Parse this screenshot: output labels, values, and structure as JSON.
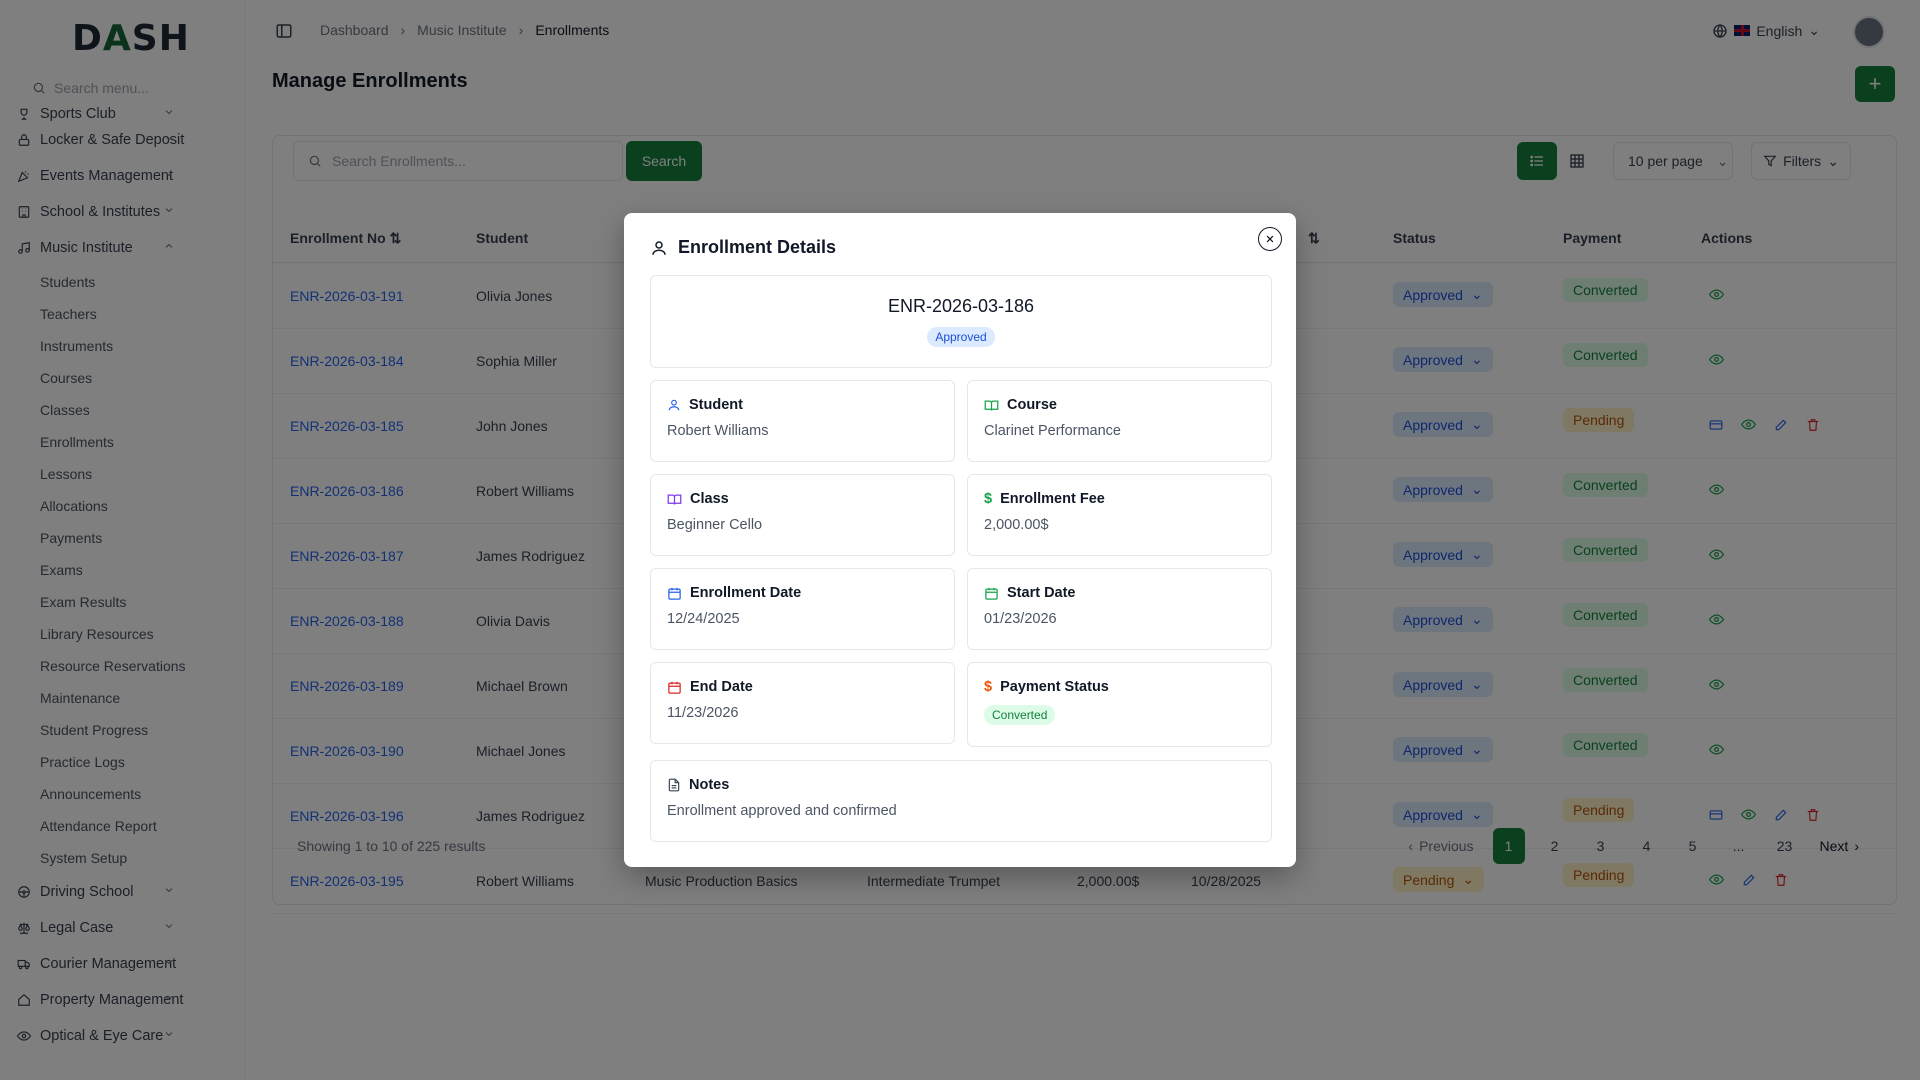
{
  "app": {
    "logo": "DASH"
  },
  "sidebar": {
    "search_placeholder": "Search menu...",
    "items": [
      {
        "label": "Sports Club"
      },
      {
        "label": "Locker & Safe Deposit"
      },
      {
        "label": "Events Management"
      },
      {
        "label": "School & Institutes"
      },
      {
        "label": "Music Institute"
      }
    ],
    "sub_items": [
      "Students",
      "Teachers",
      "Instruments",
      "Courses",
      "Classes",
      "Enrollments",
      "Lessons",
      "Allocations",
      "Payments",
      "Exams",
      "Exam Results",
      "Library Resources",
      "Resource Reservations",
      "Maintenance",
      "Student Progress",
      "Practice Logs",
      "Announcements",
      "Attendance Report",
      "System Setup"
    ],
    "after_items": [
      {
        "label": "Driving School"
      },
      {
        "label": "Legal Case"
      },
      {
        "label": "Courier Management"
      },
      {
        "label": "Property Management"
      },
      {
        "label": "Optical & Eye Care"
      }
    ]
  },
  "header": {
    "breadcrumbs": [
      "Dashboard",
      "Music Institute",
      "Enrollments"
    ],
    "language": "English"
  },
  "page": {
    "title": "Manage Enrollments",
    "add_label": "+"
  },
  "toolbar": {
    "search_placeholder": "Search Enrollments...",
    "search_label": "Search",
    "per_page": "10 per page",
    "filters_label": "Filters"
  },
  "table": {
    "headers": {
      "enrollment_no": "Enrollment No",
      "student": "Student",
      "status": "Status",
      "payment": "Payment",
      "actions": "Actions"
    },
    "rows": [
      {
        "no": "ENR-2026-03-191",
        "student": "Olivia Jones",
        "status": "Approved",
        "payment": "Converted",
        "actions": "view"
      },
      {
        "no": "ENR-2026-03-184",
        "student": "Sophia Miller",
        "status": "Approved",
        "payment": "Converted",
        "actions": "view"
      },
      {
        "no": "ENR-2026-03-185",
        "student": "John Jones",
        "status": "Approved",
        "payment": "Pending",
        "actions": "full"
      },
      {
        "no": "ENR-2026-03-186",
        "student": "Robert Williams",
        "status": "Approved",
        "payment": "Converted",
        "actions": "view"
      },
      {
        "no": "ENR-2026-03-187",
        "student": "James Rodriguez",
        "status": "Approved",
        "payment": "Converted",
        "actions": "view"
      },
      {
        "no": "ENR-2026-03-188",
        "student": "Olivia Davis",
        "status": "Approved",
        "payment": "Converted",
        "actions": "view"
      },
      {
        "no": "ENR-2026-03-189",
        "student": "Michael Brown",
        "status": "Approved",
        "payment": "Converted",
        "actions": "view"
      },
      {
        "no": "ENR-2026-03-190",
        "student": "Michael Jones",
        "status": "Approved",
        "payment": "Converted",
        "actions": "view"
      },
      {
        "no": "ENR-2026-03-196",
        "student": "James Rodriguez",
        "status": "Approved",
        "payment": "Pending",
        "actions": "full"
      },
      {
        "no": "ENR-2026-03-195",
        "student": "Robert Williams",
        "course": "Music Production Basics",
        "class": "Intermediate Trumpet",
        "fee": "2,000.00$",
        "date": "10/28/2025",
        "status": "Pending",
        "payment": "Pending",
        "actions": "edit"
      }
    ]
  },
  "pagination": {
    "showing": "Showing 1 to 10 of 225 results",
    "previous": "Previous",
    "pages": [
      "1",
      "2",
      "3",
      "4",
      "5"
    ],
    "ellipsis": "...",
    "last": "23",
    "next": "Next"
  },
  "modal": {
    "title": "Enrollment Details",
    "enrollment_no": "ENR-2026-03-186",
    "status": "Approved",
    "student_label": "Student",
    "student": "Robert Williams",
    "course_label": "Course",
    "course": "Clarinet Performance",
    "class_label": "Class",
    "class": "Beginner Cello",
    "fee_label": "Enrollment Fee",
    "fee": "2,000.00$",
    "enroll_date_label": "Enrollment Date",
    "enroll_date": "12/24/2025",
    "start_date_label": "Start Date",
    "start_date": "01/23/2026",
    "end_date_label": "End Date",
    "end_date": "11/23/2026",
    "payment_label": "Payment Status",
    "payment": "Converted",
    "notes_label": "Notes",
    "notes": "Enrollment approved and confirmed"
  },
  "colors": {
    "primary": "#15803d",
    "link": "#2563eb",
    "approved": "#1d4ed8",
    "pending": "#b45309",
    "danger": "#dc2626"
  }
}
